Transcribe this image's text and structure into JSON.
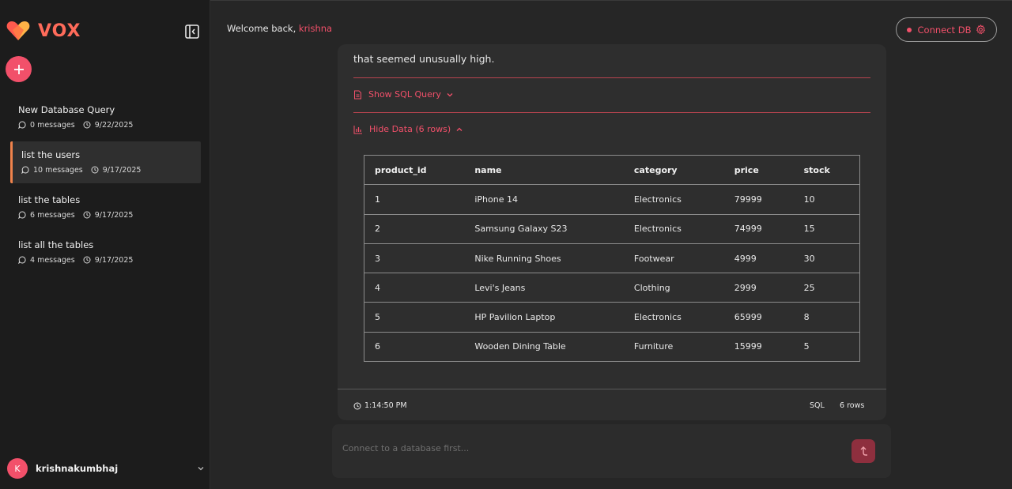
{
  "brand": {
    "name": "VOX",
    "accent": "#f2506a",
    "logo_colors": [
      "#ff5a4e",
      "#ffb347"
    ]
  },
  "sidebar": {
    "chats": [
      {
        "title": "New Database Query",
        "messages": "0 messages",
        "date": "9/22/2025",
        "active": false
      },
      {
        "title": "list the users",
        "messages": "10 messages",
        "date": "9/17/2025",
        "active": true
      },
      {
        "title": "list the tables",
        "messages": "6 messages",
        "date": "9/17/2025",
        "active": false
      },
      {
        "title": "list all the tables",
        "messages": "4 messages",
        "date": "9/17/2025",
        "active": false
      }
    ],
    "user": {
      "initial": "K",
      "name": "krishnakumbhaj"
    }
  },
  "header": {
    "welcome": "Welcome back,",
    "username": "krishna",
    "connect_label": "Connect DB"
  },
  "message": {
    "text_tail": "that seemed unusually high.",
    "show_sql_label": "Show SQL Query",
    "hide_data_label": "Hide Data (6 rows)",
    "table": {
      "columns": [
        "product_id",
        "name",
        "category",
        "price",
        "stock"
      ],
      "rows": [
        [
          "1",
          "iPhone 14",
          "Electronics",
          "79999",
          "10"
        ],
        [
          "2",
          "Samsung Galaxy S23",
          "Electronics",
          "74999",
          "15"
        ],
        [
          "3",
          "Nike Running Shoes",
          "Footwear",
          "4999",
          "30"
        ],
        [
          "4",
          "Levi's Jeans",
          "Clothing",
          "2999",
          "25"
        ],
        [
          "5",
          "HP Pavilion Laptop",
          "Electronics",
          "65999",
          "8"
        ],
        [
          "6",
          "Wooden Dining Table",
          "Furniture",
          "15999",
          "5"
        ]
      ]
    },
    "footer": {
      "time": "1:14:50 PM",
      "type": "SQL",
      "rows": "6 rows"
    }
  },
  "input": {
    "placeholder": "Connect to a database first..."
  }
}
